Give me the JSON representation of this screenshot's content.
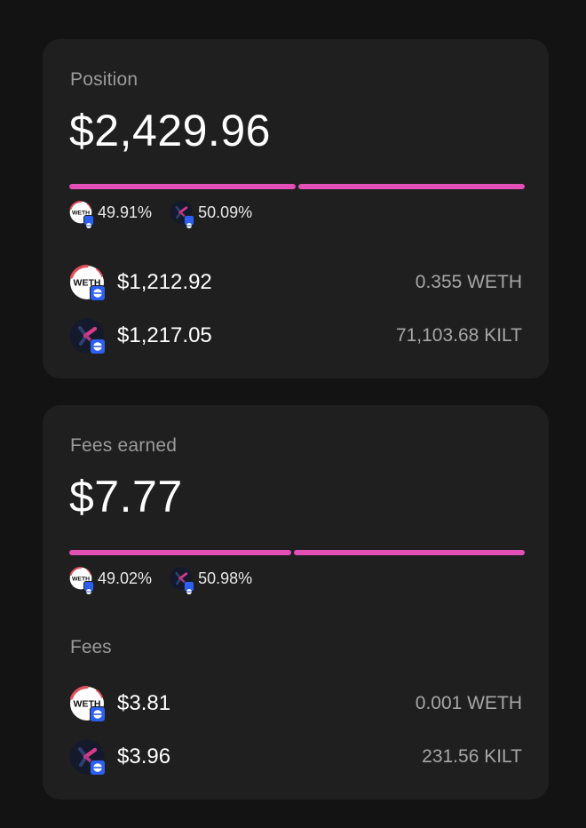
{
  "position": {
    "label": "Position",
    "value": "$2,429.96",
    "split": [
      {
        "token": "WETH",
        "icon": "weth-icon",
        "percent_text": "49.91%",
        "share": 0.4991
      },
      {
        "token": "KILT",
        "icon": "kilt-icon",
        "percent_text": "50.09%",
        "share": 0.5009
      }
    ],
    "rows": [
      {
        "token": "WETH",
        "icon": "weth-icon",
        "usd": "$1,212.92",
        "amount": "0.355 WETH"
      },
      {
        "token": "KILT",
        "icon": "kilt-icon",
        "usd": "$1,217.05",
        "amount": "71,103.68 KILT"
      }
    ]
  },
  "fees_earned": {
    "label": "Fees earned",
    "value": "$7.77",
    "split": [
      {
        "token": "WETH",
        "icon": "weth-icon",
        "percent_text": "49.02%",
        "share": 0.4902
      },
      {
        "token": "KILT",
        "icon": "kilt-icon",
        "percent_text": "50.98%",
        "share": 0.5098
      }
    ],
    "fees_label": "Fees",
    "rows": [
      {
        "token": "WETH",
        "icon": "weth-icon",
        "usd": "$3.81",
        "amount": "0.001 WETH"
      },
      {
        "token": "KILT",
        "icon": "kilt-icon",
        "usd": "$3.96",
        "amount": "231.56 KILT"
      }
    ]
  },
  "icons": {
    "weth_text": "WETH",
    "chain_icon": "base-chain-icon"
  },
  "colors": {
    "background": "#131313",
    "card": "#1f1f1f",
    "accent": "#e34fb7",
    "chain": "#2c5ff6",
    "muted_text": "#9b9b9b"
  }
}
